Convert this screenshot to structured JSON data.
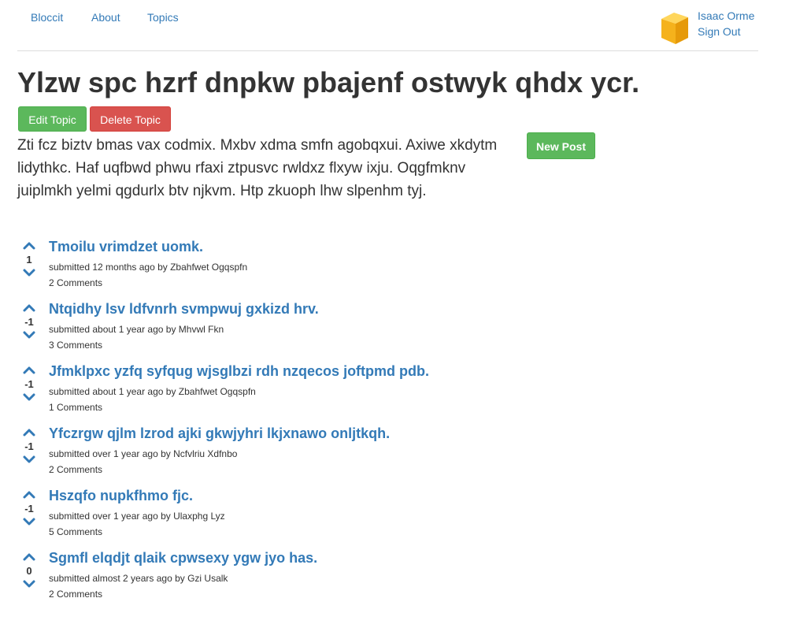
{
  "nav": {
    "brand": "Bloccit",
    "about": "About",
    "topics": "Topics"
  },
  "user": {
    "name": "Isaac Orme",
    "sign_out": "Sign Out",
    "avatar_icon": "cube-avatar-icon"
  },
  "topic": {
    "title": "Ylzw spc hzrf dnpkw pbajenf ostwyk qhdx ycr.",
    "edit_label": "Edit Topic",
    "delete_label": "Delete Topic",
    "description": "Zti fcz biztv bmas vax codmix. Mxbv xdma smfn agobqxui. Axiwe xkdytm lidythkc. Haf uqfbwd phwu rfaxi ztpusvc rwldxz flxyw ixju. Oqgfmknv juiplmkh yelmi qgdurlx btv njkvm. Htp zkuoph lhw slpenhm tyj.",
    "new_post_label": "New Post"
  },
  "colors": {
    "link": "#337ab7",
    "success": "#5cb85c",
    "danger": "#d9534f"
  },
  "posts": [
    {
      "votes": "1",
      "title": "Tmoilu vrimdzet uomk.",
      "meta": "submitted 12 months ago by Zbahfwet Ogqspfn",
      "comments": "2 Comments"
    },
    {
      "votes": "-1",
      "title": "Ntqidhy lsv ldfvnrh svmpwuj gxkizd hrv.",
      "meta": "submitted about 1 year ago by Mhvwl Fkn",
      "comments": "3 Comments"
    },
    {
      "votes": "-1",
      "title": "Jfmklpxc yzfq syfqug wjsglbzi rdh nzqecos joftpmd pdb.",
      "meta": "submitted about 1 year ago by Zbahfwet Ogqspfn",
      "comments": "1 Comments"
    },
    {
      "votes": "-1",
      "title": "Yfczrgw qjlm lzrod ajki gkwjyhri lkjxnawo onljtkqh.",
      "meta": "submitted over 1 year ago by Ncfvlriu Xdfnbo",
      "comments": "2 Comments"
    },
    {
      "votes": "-1",
      "title": "Hszqfo nupkfhmo fjc.",
      "meta": "submitted over 1 year ago by Ulaxphg Lyz",
      "comments": "5 Comments"
    },
    {
      "votes": "0",
      "title": "Sgmfl elqdjt qlaik cpwsexy ygw jyo has.",
      "meta": "submitted almost 2 years ago by Gzi Usalk",
      "comments": "2 Comments"
    }
  ]
}
